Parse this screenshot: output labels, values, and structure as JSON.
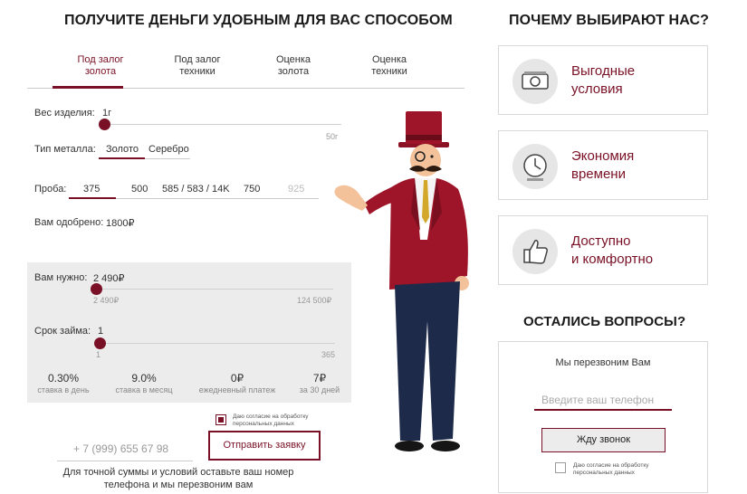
{
  "main": {
    "title": "ПОЛУЧИТЕ ДЕНЬГИ УДОБНЫМ ДЛЯ ВАС СПОСОБОМ",
    "tabs": [
      {
        "line1": "Под залог",
        "line2": "золота"
      },
      {
        "line1": "Под залог",
        "line2": "техники"
      },
      {
        "line1": "Оценка",
        "line2": "золота"
      },
      {
        "line1": "Оценка",
        "line2": "техники"
      }
    ],
    "weight": {
      "label": "Вес изделия:",
      "value": "1г",
      "max": "50г",
      "level": 0.0
    },
    "metal": {
      "label": "Тип металла:",
      "options": [
        "Золото",
        "Серебро"
      ],
      "selected": "Золото"
    },
    "probe": {
      "label": "Проба:",
      "options": [
        "375",
        "500",
        "585 / 583 / 14K",
        "750",
        "925"
      ],
      "selected": "375"
    },
    "approved": {
      "label": "Вам одобрено:",
      "value": "1800₽"
    }
  },
  "calc": {
    "need": {
      "label": "Вам нужно:",
      "value": "2 490₽",
      "min": "2 490₽",
      "max": "124 500₽",
      "level": 0.0
    },
    "term": {
      "label": "Срок займа:",
      "value": "1",
      "min": "1",
      "max": "365",
      "level": 0.0
    },
    "stats": [
      {
        "value": "0.30%",
        "label": "ставка в день"
      },
      {
        "value": "9.0%",
        "label": "ставка в месяц"
      },
      {
        "value": "0₽",
        "label": "ежедневный платеж"
      },
      {
        "value": "7₽",
        "label": "за 30 дней"
      }
    ]
  },
  "form": {
    "consent": "Даю согласие на обработку персональных данных",
    "phone_placeholder": "+ 7 (999) 655 67 98",
    "submit": "Отправить заявку",
    "note": "Для точной суммы и условий оставьте ваш номер телефона и мы перезвоним вам"
  },
  "side": {
    "title": "ПОЧЕМУ ВЫБИРАЮТ НАС?",
    "cards": [
      {
        "text": "Выгодные\nусловия",
        "icon": "money-icon"
      },
      {
        "text": "Экономия\nвремени",
        "icon": "clock-icon"
      },
      {
        "text": "Доступно\nи комфортно",
        "icon": "thumbs-up-icon"
      }
    ],
    "questions_title": "ОСТАЛИСЬ ВОПРОСЫ?",
    "callback": {
      "title": "Мы перезвоним Вам",
      "placeholder": "Введите ваш телефон",
      "button": "Жду звонок",
      "consent": "Даю согласие на обработку персональных данных"
    }
  },
  "colors": {
    "accent": "#7a1025",
    "gray_bg": "#ececec"
  }
}
